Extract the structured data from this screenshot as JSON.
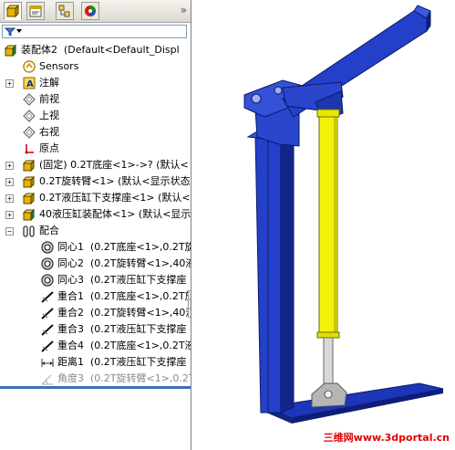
{
  "tabs": [
    {
      "name": "feature-manager",
      "icon": "feature-tree-icon"
    },
    {
      "name": "property-manager",
      "icon": "property-manager-icon"
    },
    {
      "name": "configuration-manager",
      "icon": "configuration-manager-icon"
    },
    {
      "name": "display-manager",
      "icon": "appearance-icon"
    }
  ],
  "tree": {
    "root": "装配体2  (Default<Default_Displ",
    "items": [
      {
        "label": "Sensors",
        "icon": "sensors-icon"
      },
      {
        "label": "注解",
        "icon": "annotations-icon"
      },
      {
        "label": "前视",
        "icon": "plane-icon"
      },
      {
        "label": "上视",
        "icon": "plane-icon"
      },
      {
        "label": "右视",
        "icon": "plane-icon"
      },
      {
        "label": "原点",
        "icon": "origin-icon"
      },
      {
        "label": "(固定) 0.2T底座<1>->? (默认<",
        "icon": "part-icon"
      },
      {
        "label": "0.2T旋转臂<1> (默认<显示状态",
        "icon": "part-icon"
      },
      {
        "label": "0.2T液压缸下支撑座<1> (默认<",
        "icon": "part-icon"
      },
      {
        "label": "40液压缸装配体<1> (默认<显示",
        "icon": "subassembly-icon"
      },
      {
        "label": "配合",
        "icon": "mates-icon"
      }
    ],
    "mates": [
      {
        "label": "同心1  (0.2T底座<1>,0.2T旋",
        "icon": "concentric-icon"
      },
      {
        "label": "同心2  (0.2T旋转臂<1>,40液",
        "icon": "concentric-icon"
      },
      {
        "label": "同心3  (0.2T液压缸下支撑座",
        "icon": "concentric-icon"
      },
      {
        "label": "重合1  (0.2T底座<1>,0.2T旋",
        "icon": "coincident-icon"
      },
      {
        "label": "重合2  (0.2T旋转臂<1>,40液",
        "icon": "coincident-icon"
      },
      {
        "label": "重合3  (0.2T液压缸下支撑座",
        "icon": "coincident-icon"
      },
      {
        "label": "重合4  (0.2T底座<1>,0.2T液",
        "icon": "coincident-icon"
      },
      {
        "label": "距离1  (0.2T液压缸下支撑座",
        "icon": "distance-icon"
      },
      {
        "label": "角度3  (0.2T旋转臂<1>,0.2T",
        "icon": "angle-icon",
        "suppressed": true
      }
    ]
  },
  "graphics": {
    "watermark": "三维网www.3dportal.cn"
  },
  "colors": {
    "frame": "#1530b0",
    "cylinder": "#f2f20a",
    "rod": "#d0d0d0",
    "watermark": "#e00000"
  }
}
